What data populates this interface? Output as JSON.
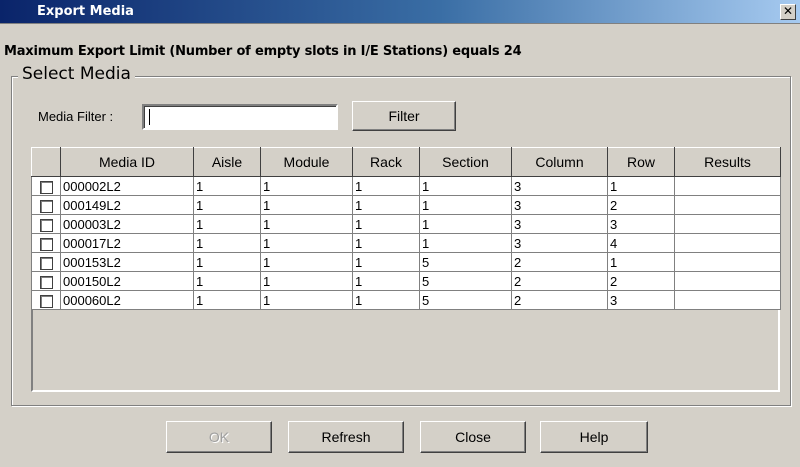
{
  "window": {
    "title": "Export Media",
    "close_glyph": "✕"
  },
  "limit_text": "Maximum Export Limit (Number of empty slots in I/E Stations) equals 24",
  "group_label": "Select Media",
  "filter": {
    "label": "Media Filter :",
    "value": "",
    "button_label": "Filter"
  },
  "table": {
    "headers": [
      "",
      "Media ID",
      "Aisle",
      "Module",
      "Rack",
      "Section",
      "Column",
      "Row",
      "Results"
    ],
    "rows": [
      [
        "000002L2",
        "1",
        "1",
        "1",
        "1",
        "3",
        "1",
        ""
      ],
      [
        "000149L2",
        "1",
        "1",
        "1",
        "1",
        "3",
        "2",
        ""
      ],
      [
        "000003L2",
        "1",
        "1",
        "1",
        "1",
        "3",
        "3",
        ""
      ],
      [
        "000017L2",
        "1",
        "1",
        "1",
        "1",
        "3",
        "4",
        ""
      ],
      [
        "000153L2",
        "1",
        "1",
        "1",
        "5",
        "2",
        "1",
        ""
      ],
      [
        "000150L2",
        "1",
        "1",
        "1",
        "5",
        "2",
        "2",
        ""
      ],
      [
        "000060L2",
        "1",
        "1",
        "1",
        "5",
        "2",
        "3",
        ""
      ]
    ]
  },
  "buttons": {
    "ok": "OK",
    "refresh": "Refresh",
    "close": "Close",
    "help": "Help"
  }
}
